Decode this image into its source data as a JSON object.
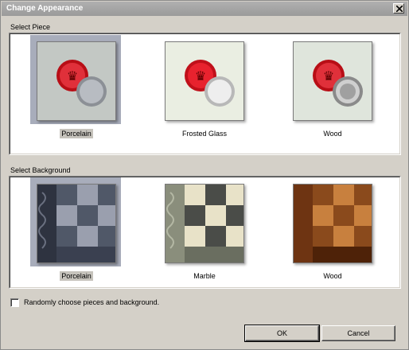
{
  "window": {
    "title": "Change Appearance",
    "close_icon": "close-icon"
  },
  "pieces": {
    "label": "Select Piece",
    "items": [
      {
        "name": "Porcelain",
        "selected": true
      },
      {
        "name": "Frosted Glass",
        "selected": false
      },
      {
        "name": "Wood",
        "selected": false
      }
    ]
  },
  "backgrounds": {
    "label": "Select Background",
    "items": [
      {
        "name": "Porcelain",
        "selected": true
      },
      {
        "name": "Marble",
        "selected": false
      },
      {
        "name": "Wood",
        "selected": false
      }
    ]
  },
  "random_option": {
    "label": "Randomly choose pieces and background.",
    "checked": false
  },
  "buttons": {
    "ok": "OK",
    "cancel": "Cancel"
  },
  "colors": {
    "selection_highlight": "#a8adbb",
    "piece_red": "#c8141c",
    "window_bg": "#d4d0c8"
  }
}
